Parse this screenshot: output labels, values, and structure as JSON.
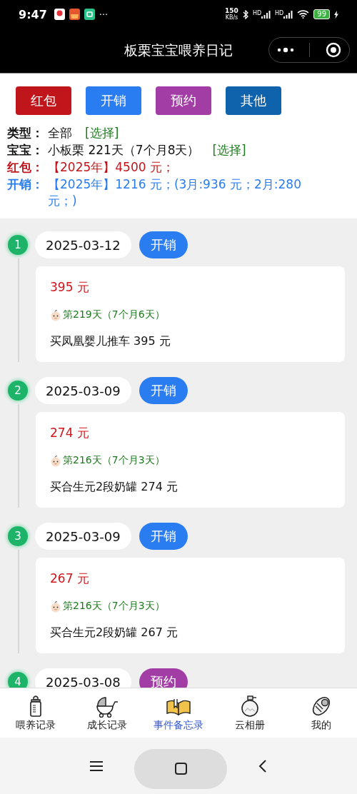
{
  "status_bar": {
    "time": "9:47",
    "speed_value": "150",
    "speed_unit": "KB/s",
    "signals": [
      "HD",
      "HD"
    ],
    "battery": "99",
    "more": "···"
  },
  "title_bar": {
    "title": "板栗宝宝喂养日记"
  },
  "filter_buttons": [
    {
      "label": "红包",
      "color": "#c0161b"
    },
    {
      "label": "开销",
      "color": "#2a7df0"
    },
    {
      "label": "预约",
      "color": "#a33da6"
    },
    {
      "label": "其他",
      "color": "#0f63ad"
    }
  ],
  "summary": [
    {
      "label": "类型：",
      "value": "全部",
      "link": "[选择]",
      "color": "#111111"
    },
    {
      "label": "宝宝：",
      "value": "小板栗 221天（7个月8天）",
      "link": "[选择]",
      "color": "#111111"
    },
    {
      "label": "红包：",
      "value": "【2025年】4500 元；",
      "color": "#c0161b"
    },
    {
      "label": "开销：",
      "value": "【2025年】1216 元；(3月:936 元；2月:280 元；)",
      "color": "#2a7df0"
    }
  ],
  "entries": [
    {
      "number": "1",
      "date": "2025-03-12",
      "tag": "开销",
      "color": "#2a7df0",
      "amount": "395 元",
      "age": "第219天（7个月6天）",
      "description": "买凤凰婴儿推车 395 元"
    },
    {
      "number": "2",
      "date": "2025-03-09",
      "tag": "开销",
      "color": "#2a7df0",
      "amount": "274 元",
      "age": "第216天（7个月3天）",
      "description": "买合生元2段奶罐 274 元"
    },
    {
      "number": "3",
      "date": "2025-03-09",
      "tag": "开销",
      "color": "#2a7df0",
      "amount": "267 元",
      "age": "第216天（7个月3天）",
      "description": "买合生元2段奶罐 267 元"
    },
    {
      "number": "4",
      "date": "2025-03-08",
      "tag": "预约",
      "color": "#a33da6"
    }
  ],
  "tab_bar": [
    {
      "label": "喂养记录",
      "selected": false
    },
    {
      "label": "成长记录",
      "selected": false
    },
    {
      "label": "事件备忘录",
      "selected": true
    },
    {
      "label": "云相册",
      "selected": false
    },
    {
      "label": "我的",
      "selected": false
    }
  ]
}
